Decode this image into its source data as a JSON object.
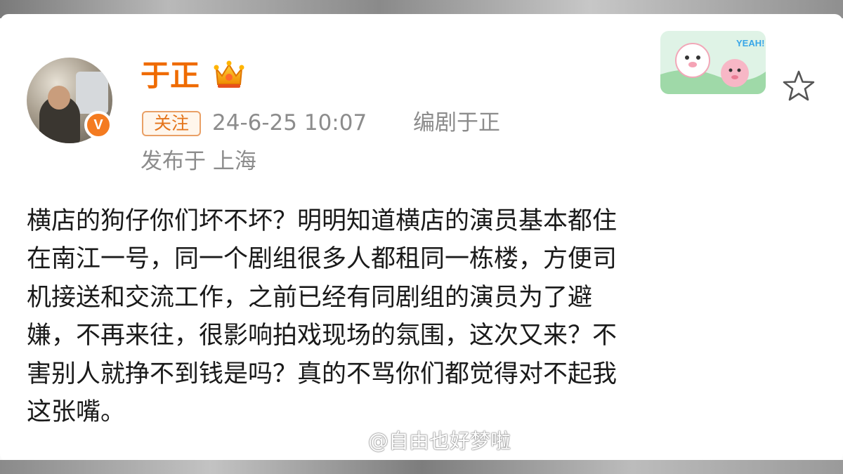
{
  "post": {
    "author": {
      "name": "于正",
      "verified_mark": "V"
    },
    "follow_label": "关注",
    "timestamp": "24-6-25 10:07",
    "source": "编剧于正",
    "location": "发布于 上海",
    "content_lines": [
      "横店的狗仔你们坏不坏？明明知道横店的演员基本都住",
      "在南江一号，同一个剧组很多人都租同一栋楼，方便司",
      "机接送和交流工作，之前已经有同剧组的演员为了避",
      "嫌，不再来往，很影响拍戏现场的氛围，这次又来？不",
      "害别人就挣不到钱是吗？真的不骂你们都觉得对不起我",
      "这张嘴。"
    ],
    "sticker_text": "YEAH!"
  },
  "watermark": {
    "text": "@自由也好梦啦"
  },
  "icons": {
    "crown": "crown-icon",
    "star": "star-icon",
    "watermark_logo": "weibo-logo-icon"
  },
  "colors": {
    "username": "#ef6b00",
    "follow_border": "#e9a066",
    "meta_text": "#8c8c8c",
    "verified": "#f47b20"
  }
}
